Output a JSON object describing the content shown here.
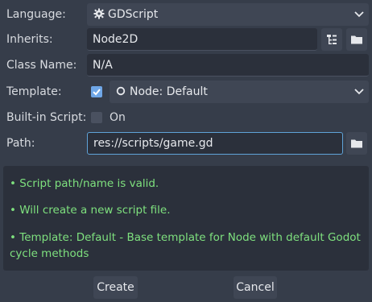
{
  "rows": {
    "language": {
      "label": "Language:",
      "value": "GDScript",
      "icon": "gear-icon"
    },
    "inherits": {
      "label": "Inherits:",
      "value": "Node2D"
    },
    "class_name": {
      "label": "Class Name:",
      "value": "N/A"
    },
    "template": {
      "label": "Template:",
      "checked": true,
      "value": "Node: Default",
      "icon": "node-circle-icon"
    },
    "builtin": {
      "label": "Built-in Script:",
      "checked": false,
      "toggle_label": "On"
    },
    "path": {
      "label": "Path:",
      "value": "res://scripts/game.gd"
    }
  },
  "messages": [
    "•  Script path/name is valid.",
    "•  Will create a new script file.",
    "•  Template: Default - Base template for Node with default Godot",
    "cycle methods"
  ],
  "buttons": {
    "create": "Create",
    "cancel": "Cancel"
  },
  "colors": {
    "accent": "#6fa7e8",
    "success_text": "#7ee07e",
    "background": "#363d4a"
  }
}
